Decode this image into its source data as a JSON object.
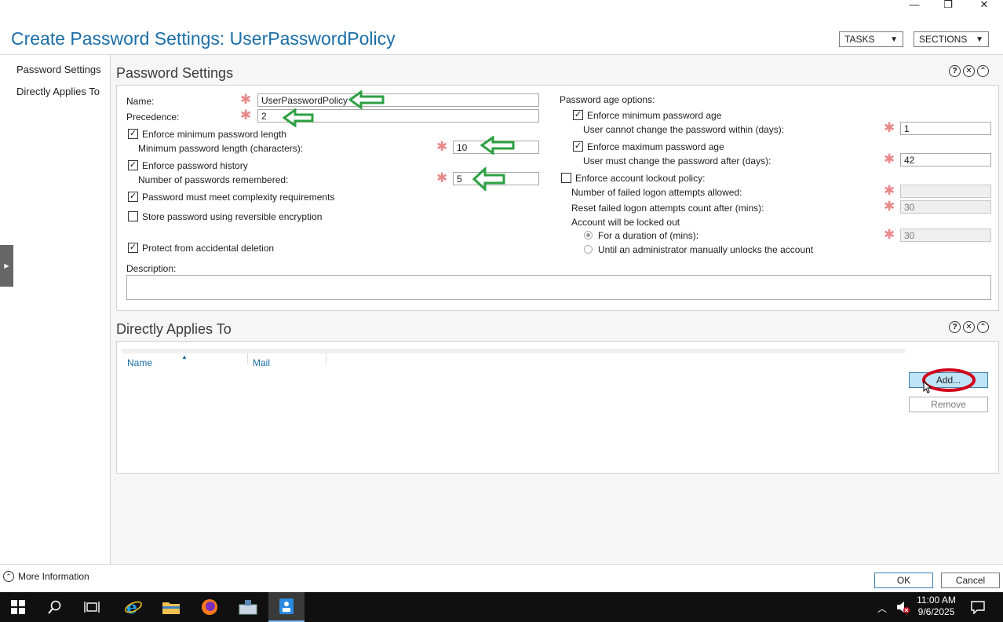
{
  "window": {
    "title": "Create Password Settings: UserPasswordPolicy",
    "controls": {
      "minimize": "—",
      "restore": "❐",
      "close": "✕"
    }
  },
  "header": {
    "tasks_label": "TASKS",
    "sections_label": "SECTIONS"
  },
  "nav": {
    "items": [
      {
        "label": "Password Settings"
      },
      {
        "label": "Directly Applies To"
      }
    ]
  },
  "password_settings": {
    "title": "Password Settings",
    "name_label": "Name:",
    "name_value": "UserPasswordPolicy",
    "precedence_label": "Precedence:",
    "precedence_value": "2",
    "enforce_min_length_label": "Enforce minimum password length",
    "enforce_min_length_checked": true,
    "min_length_label": "Minimum password length (characters):",
    "min_length_value": "10",
    "enforce_history_label": "Enforce password history",
    "enforce_history_checked": true,
    "history_label": "Number of passwords remembered:",
    "history_value": "5",
    "complexity_label": "Password must meet complexity requirements",
    "complexity_checked": true,
    "reversible_label": "Store password using reversible encryption",
    "reversible_checked": false,
    "protect_label": "Protect from accidental deletion",
    "protect_checked": true,
    "description_label": "Description:",
    "description_value": "",
    "age_options_label": "Password age options:",
    "enforce_min_age_label": "Enforce minimum password age",
    "enforce_min_age_checked": true,
    "min_age_label": "User cannot change the password within (days):",
    "min_age_value": "1",
    "enforce_max_age_label": "Enforce maximum password age",
    "enforce_max_age_checked": true,
    "max_age_label": "User must change the password after (days):",
    "max_age_value": "42",
    "lockout_label": "Enforce account lockout policy:",
    "lockout_checked": false,
    "failed_attempts_label": "Number of failed logon attempts allowed:",
    "failed_attempts_value": "",
    "reset_count_label": "Reset failed logon attempts count after (mins):",
    "reset_count_value": "30",
    "locked_out_label": "Account will be locked out",
    "duration_label": "For a duration of (mins):",
    "duration_value": "30",
    "until_admin_label": "Until an administrator manually unlocks the account",
    "check_mark": "✓",
    "required_mark": "✱"
  },
  "directly_applies_to": {
    "title": "Directly Applies To",
    "columns": [
      "Name",
      "Mail"
    ],
    "add_label": "Add...",
    "remove_label": "Remove"
  },
  "section_icons": {
    "help": "?",
    "close": "✕",
    "collapse": "⌃"
  },
  "footer": {
    "more_info_label": "More Information",
    "ok_label": "OK",
    "cancel_label": "Cancel"
  },
  "taskbar": {
    "time": "11:00 AM",
    "date": "9/6/2025"
  },
  "colors": {
    "accent": "#1b6ea8",
    "required": "#e8898a",
    "annotation_arrow": "#2ea043",
    "annotation_circle": "#d0021b",
    "add_button_bg": "#bfe3f7"
  }
}
